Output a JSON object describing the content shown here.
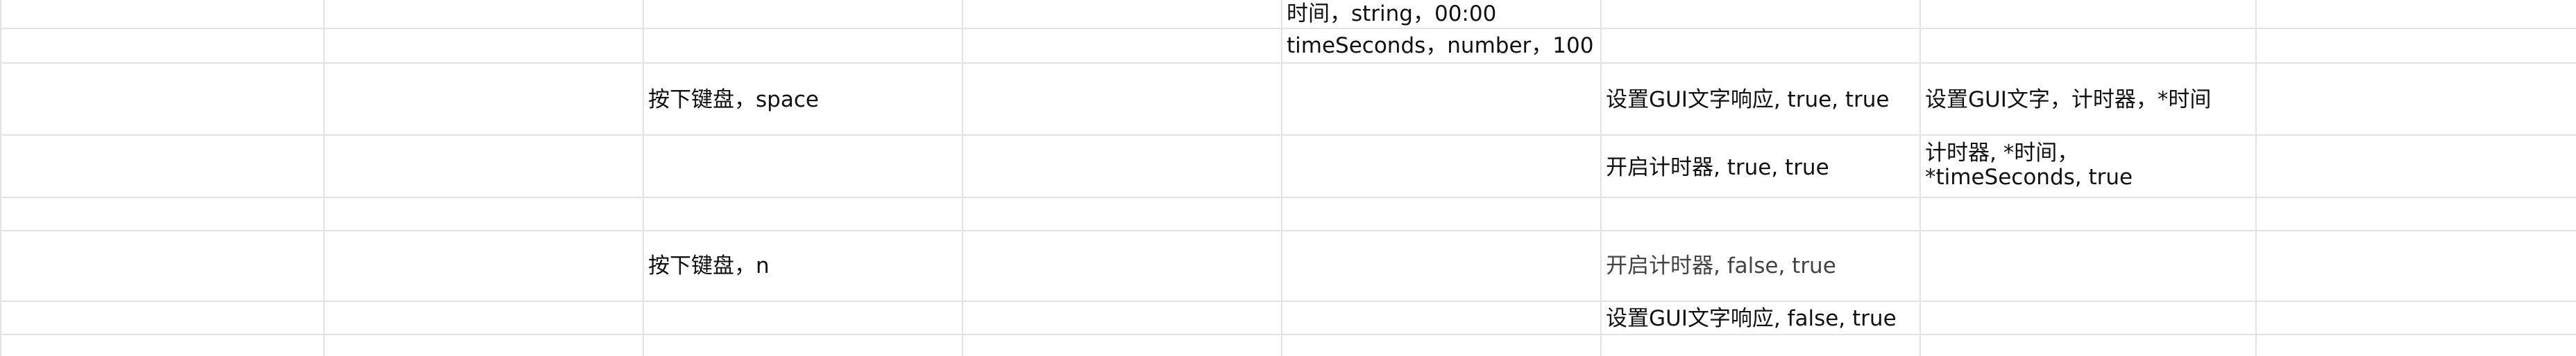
{
  "sheet": {
    "rows": [
      {
        "cells": {
          "e": "时间，string，00:00"
        }
      },
      {
        "cells": {
          "e": "timeSeconds，number，100"
        }
      },
      {
        "cells": {
          "c": "按下键盘，space",
          "f": "设置GUI文字响应, true, true",
          "g": "设置GUI文字，计时器，*时间"
        }
      },
      {
        "cells": {
          "f": "开启计时器, true, true",
          "g": "计时器, *时间， *timeSeconds, true"
        }
      },
      {
        "cells": {}
      },
      {
        "cells": {
          "c": "按下键盘，n",
          "f": "开启计时器, false, true"
        }
      },
      {
        "cells": {
          "f": "设置GUI文字响应, false, true"
        }
      }
    ]
  },
  "colors": {
    "gridline": "#e3e3e3",
    "text": "#111111",
    "muted_text": "#444444"
  }
}
